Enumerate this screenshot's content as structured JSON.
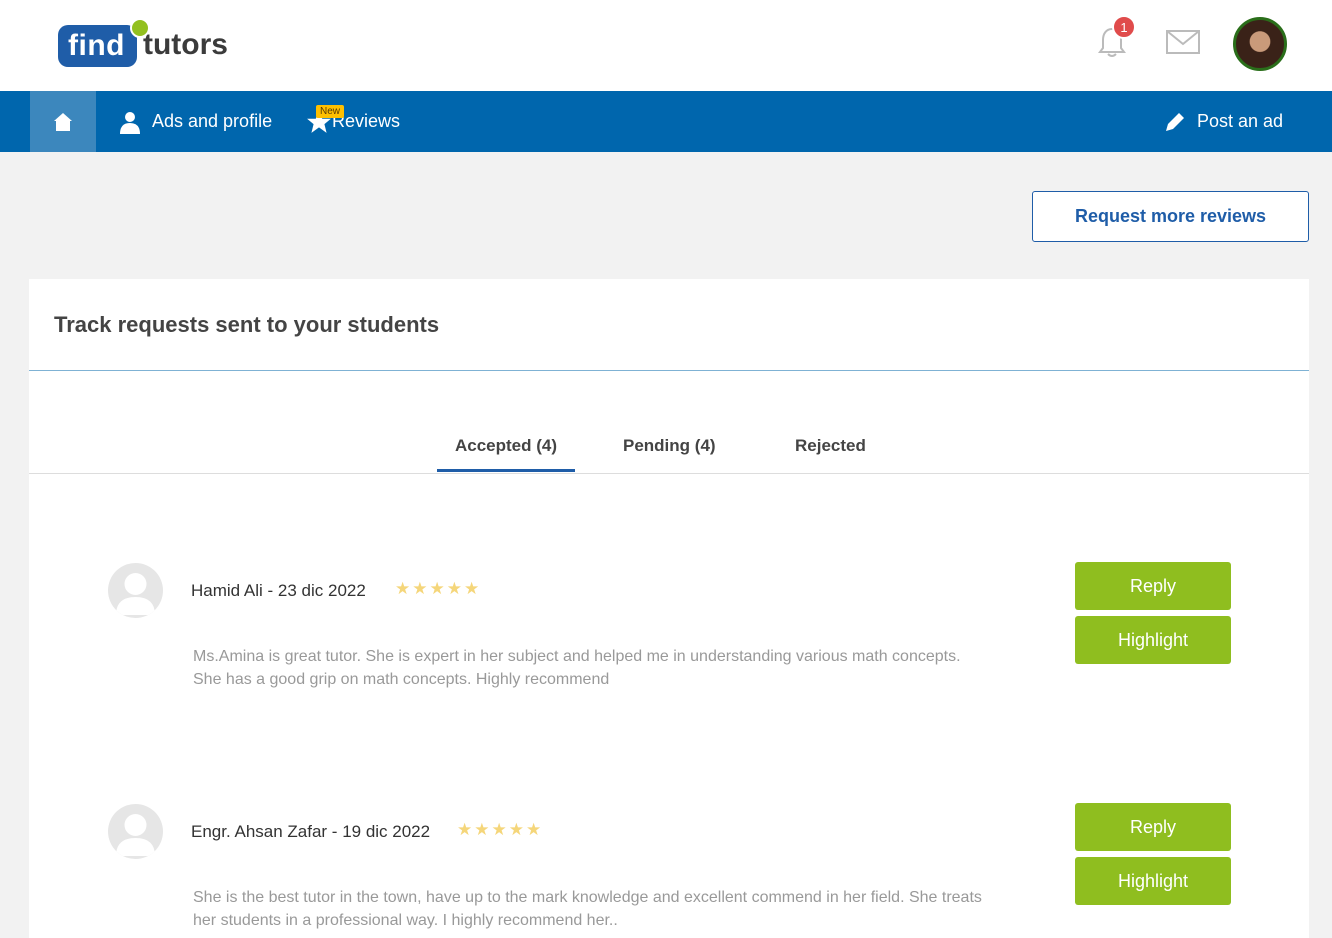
{
  "brand": {
    "logo_left": "find",
    "logo_right": "tutors",
    "primary": "#0066ad",
    "green": "#8fbe1f"
  },
  "header": {
    "notification_count": "1"
  },
  "nav": {
    "items": [
      {
        "label": "Ads and profile",
        "icon": "person-icon"
      },
      {
        "label": "Reviews",
        "icon": "star-icon",
        "tag": "New"
      }
    ],
    "post_ad": "Post an ad"
  },
  "actions": {
    "request_more": "Request more reviews"
  },
  "card": {
    "title": "Track requests sent to your students",
    "tabs": [
      "Accepted (4)",
      "Pending (4)",
      "Rejected"
    ],
    "active_tab": 0
  },
  "reviews": [
    {
      "author_date": "Hamid Ali - 23 dic 2022",
      "stars": "★★★★★",
      "text": "Ms.Amina is great tutor. She is expert in her subject and helped me in understanding various math concepts. She has a good grip on math concepts. Highly recommend",
      "reply": "Reply",
      "highlight": "Highlight"
    },
    {
      "author_date": "Engr. Ahsan Zafar - 19 dic 2022",
      "stars": "★★★★★",
      "text": "She is the best tutor in the town, have up to the mark knowledge and excellent commend in her field. She treats her students in a professional way. I highly recommend her..",
      "reply": "Reply",
      "highlight": "Highlight"
    }
  ]
}
